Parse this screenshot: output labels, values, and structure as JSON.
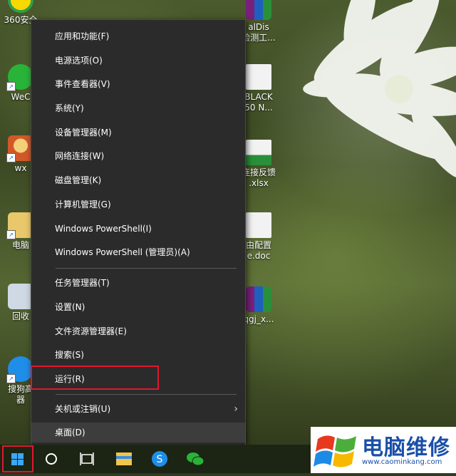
{
  "desktop": {
    "left_icons": [
      {
        "label": "360安全",
        "icon": "360-safe-icon",
        "color": "#f3c300"
      },
      {
        "label": "WeC",
        "icon": "wechat-icon",
        "color": "#29b439"
      },
      {
        "label": "wx",
        "icon": "game-character-icon",
        "color": "#d2582a"
      },
      {
        "label": "电脑",
        "icon": "folder-icon",
        "color": "#e8c86a"
      },
      {
        "label": "回收",
        "icon": "recycle-bin-icon",
        "color": "#cfd9e3"
      },
      {
        "label": "搜狗高",
        "label2": "器",
        "icon": "sogou-icon",
        "color": "#1e8ee8"
      }
    ],
    "right_icons": [
      {
        "label": "alDis",
        "label2": "检测工...",
        "icon": "archive-icon"
      },
      {
        "label": "BLACK",
        "label2": "50 N...",
        "icon": "document-icon"
      },
      {
        "label": "连接反馈",
        "label2": ".xlsx",
        "icon": "excel-file-icon"
      },
      {
        "label": "由配置",
        "label2": "e.doc",
        "icon": "word-file-icon"
      },
      {
        "label": "qgj_x...",
        "icon": "archive-icon"
      }
    ]
  },
  "context_menu": {
    "group1": [
      "应用和功能(F)",
      "电源选项(O)",
      "事件查看器(V)",
      "系统(Y)",
      "设备管理器(M)",
      "网络连接(W)",
      "磁盘管理(K)",
      "计算机管理(G)",
      "Windows PowerShell(I)",
      "Windows PowerShell (管理员)(A)"
    ],
    "group2": [
      "任务管理器(T)",
      "设置(N)",
      "文件资源管理器(E)",
      "搜索(S)",
      "运行(R)"
    ],
    "group3": [
      "关机或注销(U)",
      "桌面(D)"
    ],
    "highlighted_item": "运行(R)",
    "hovered_item": "桌面(D)"
  },
  "taskbar": {
    "buttons": [
      "start-button",
      "cortana-button",
      "task-view-button",
      "file-explorer-button",
      "sogou-browser-button",
      "wechat-button"
    ]
  },
  "watermark": {
    "title": "电脑维修",
    "url": "www.caominkang.com"
  },
  "colors": {
    "menu_bg": "#2b2b2b",
    "highlight_border": "#e0182d",
    "start_blue": "#3ea7f5",
    "logo_blue": "#1a4fa8"
  }
}
